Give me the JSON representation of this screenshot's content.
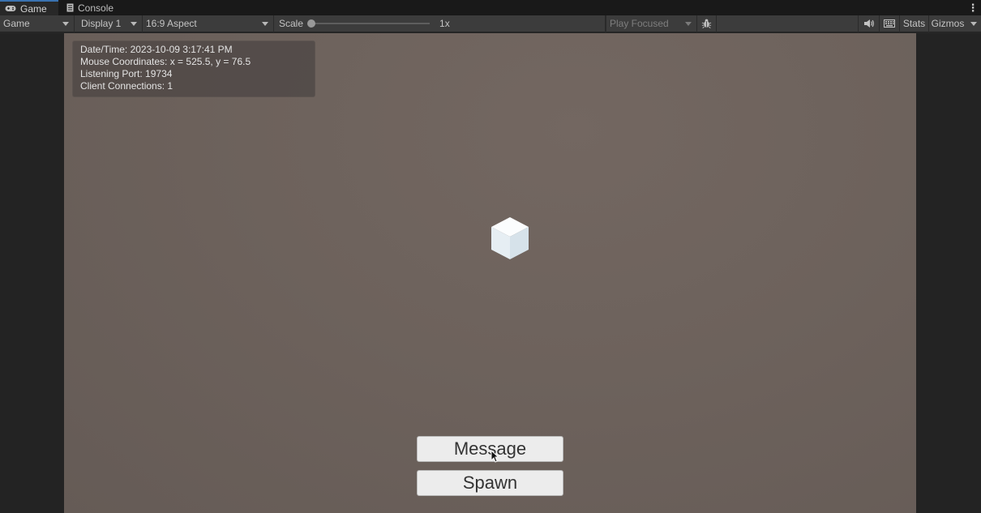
{
  "tabs": [
    {
      "label": "Game",
      "icon": "gamepad-icon",
      "active": true
    },
    {
      "label": "Console",
      "icon": "console-icon",
      "active": false
    }
  ],
  "toolbar": {
    "view_mode": "Game",
    "display": "Display 1",
    "aspect": "16:9 Aspect",
    "scale_label": "Scale",
    "scale_value": "1x",
    "scale_fraction": 0,
    "play_mode": "Play Focused",
    "stats_label": "Stats",
    "gizmos_label": "Gizmos"
  },
  "info_panel": {
    "datetime": "Date/Time: 2023-10-09 3:17:41 PM",
    "mouse": "Mouse Coordinates: x = 525.5, y = 76.5",
    "port": "Listening Port: 19734",
    "connections": "Client Connections: 1"
  },
  "buttons": {
    "message": "Message",
    "spawn": "Spawn"
  },
  "colors": {
    "accent": "#3a72b0",
    "scene_background": "#6d625c",
    "button_face": "#ececec"
  }
}
